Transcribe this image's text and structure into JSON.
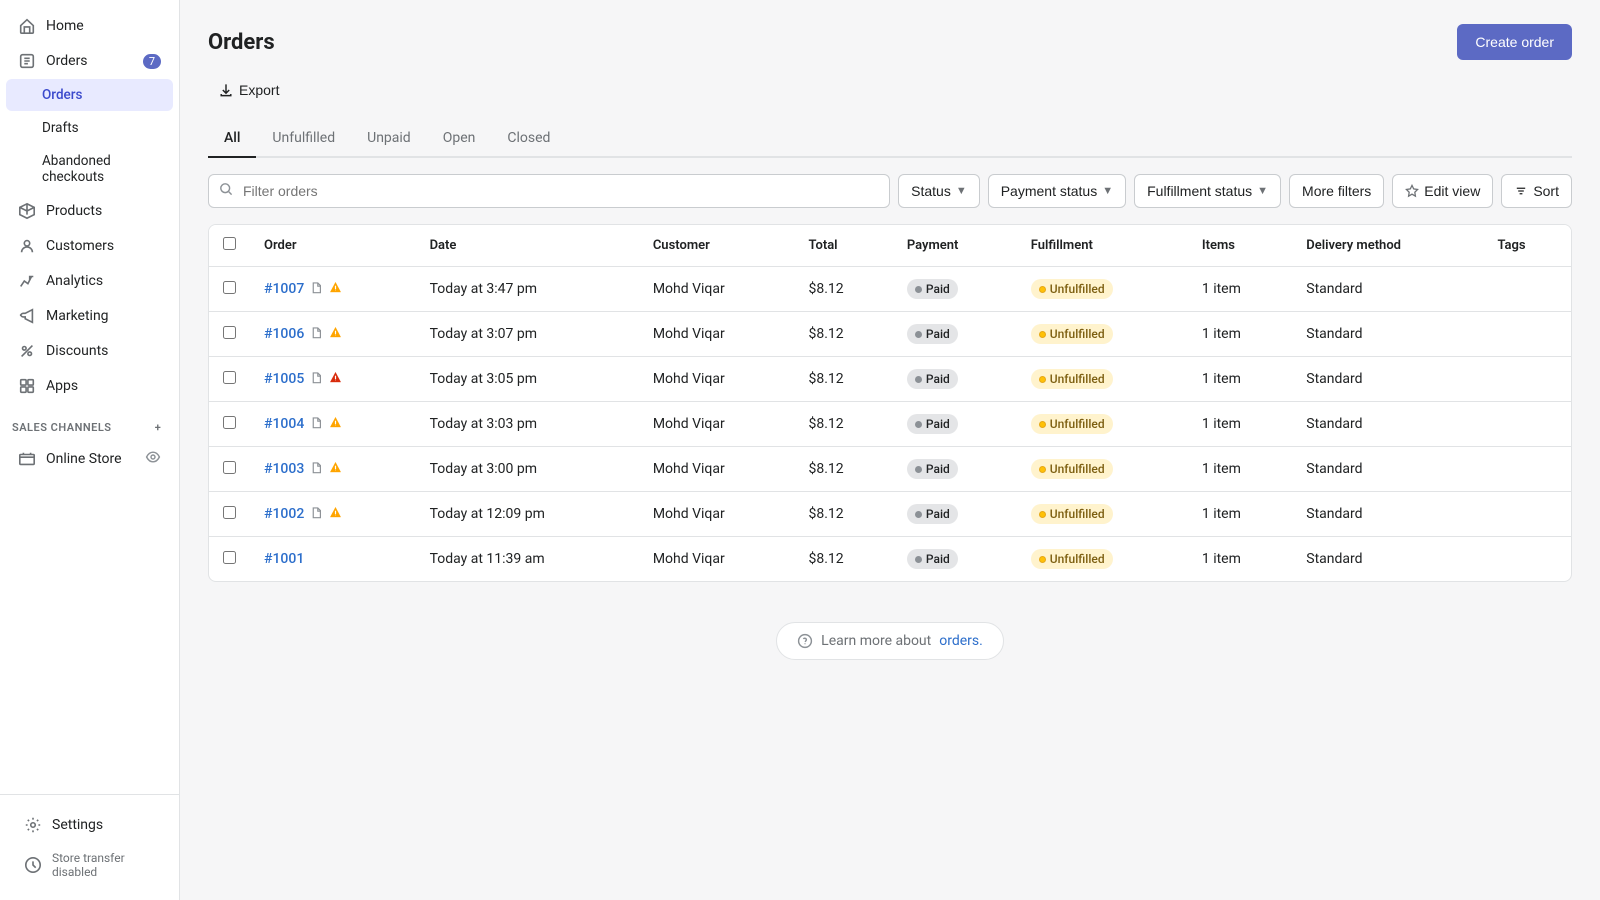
{
  "sidebar": {
    "home_label": "Home",
    "orders_label": "Orders",
    "orders_badge": "7",
    "orders_sub": {
      "orders": "Orders",
      "drafts": "Drafts",
      "abandoned": "Abandoned checkouts"
    },
    "products_label": "Products",
    "customers_label": "Customers",
    "analytics_label": "Analytics",
    "marketing_label": "Marketing",
    "discounts_label": "Discounts",
    "apps_label": "Apps",
    "sales_channels_label": "SALES CHANNELS",
    "online_store_label": "Online Store",
    "settings_label": "Settings",
    "store_transfer_label": "Store transfer disabled"
  },
  "page": {
    "title": "Orders",
    "export_label": "Export",
    "create_order_label": "Create order"
  },
  "tabs": [
    {
      "id": "all",
      "label": "All",
      "active": true
    },
    {
      "id": "unfulfilled",
      "label": "Unfulfilled",
      "active": false
    },
    {
      "id": "unpaid",
      "label": "Unpaid",
      "active": false
    },
    {
      "id": "open",
      "label": "Open",
      "active": false
    },
    {
      "id": "closed",
      "label": "Closed",
      "active": false
    }
  ],
  "filters": {
    "search_placeholder": "Filter orders",
    "status_label": "Status",
    "payment_status_label": "Payment status",
    "fulfillment_status_label": "Fulfillment status",
    "more_filters_label": "More filters",
    "edit_view_label": "Edit view",
    "sort_label": "Sort"
  },
  "table": {
    "columns": [
      "",
      "Order",
      "Date",
      "Customer",
      "Total",
      "Payment",
      "Fulfillment",
      "Items",
      "Delivery method",
      "Tags"
    ],
    "rows": [
      {
        "id": "#1007",
        "date": "Today at 3:47 pm",
        "customer": "Mohd Viqar",
        "total": "$8.12",
        "payment": "Paid",
        "fulfillment": "Unfulfilled",
        "items": "1 item",
        "delivery": "Standard",
        "has_doc": true,
        "has_warn": true,
        "warn_red": false
      },
      {
        "id": "#1006",
        "date": "Today at 3:07 pm",
        "customer": "Mohd Viqar",
        "total": "$8.12",
        "payment": "Paid",
        "fulfillment": "Unfulfilled",
        "items": "1 item",
        "delivery": "Standard",
        "has_doc": true,
        "has_warn": true,
        "warn_red": false
      },
      {
        "id": "#1005",
        "date": "Today at 3:05 pm",
        "customer": "Mohd Viqar",
        "total": "$8.12",
        "payment": "Paid",
        "fulfillment": "Unfulfilled",
        "items": "1 item",
        "delivery": "Standard",
        "has_doc": true,
        "has_warn": true,
        "warn_red": true
      },
      {
        "id": "#1004",
        "date": "Today at 3:03 pm",
        "customer": "Mohd Viqar",
        "total": "$8.12",
        "payment": "Paid",
        "fulfillment": "Unfulfilled",
        "items": "1 item",
        "delivery": "Standard",
        "has_doc": true,
        "has_warn": true,
        "warn_red": false
      },
      {
        "id": "#1003",
        "date": "Today at 3:00 pm",
        "customer": "Mohd Viqar",
        "total": "$8.12",
        "payment": "Paid",
        "fulfillment": "Unfulfilled",
        "items": "1 item",
        "delivery": "Standard",
        "has_doc": true,
        "has_warn": true,
        "warn_red": false
      },
      {
        "id": "#1002",
        "date": "Today at 12:09 pm",
        "customer": "Mohd Viqar",
        "total": "$8.12",
        "payment": "Paid",
        "fulfillment": "Unfulfilled",
        "items": "1 item",
        "delivery": "Standard",
        "has_doc": true,
        "has_warn": true,
        "warn_red": false
      },
      {
        "id": "#1001",
        "date": "Today at 11:39 am",
        "customer": "Mohd Viqar",
        "total": "$8.12",
        "payment": "Paid",
        "fulfillment": "Unfulfilled",
        "items": "1 item",
        "delivery": "Standard",
        "has_doc": false,
        "has_warn": false,
        "warn_red": false
      }
    ]
  },
  "footer": {
    "learn_more_text": "Learn more about ",
    "orders_link_text": "orders."
  },
  "colors": {
    "accent": "#5c6ac4",
    "sidebar_active_bg": "#e8eaff",
    "paid_bg": "#e4e5e7",
    "unfulfilled_bg": "#fff3cd"
  }
}
